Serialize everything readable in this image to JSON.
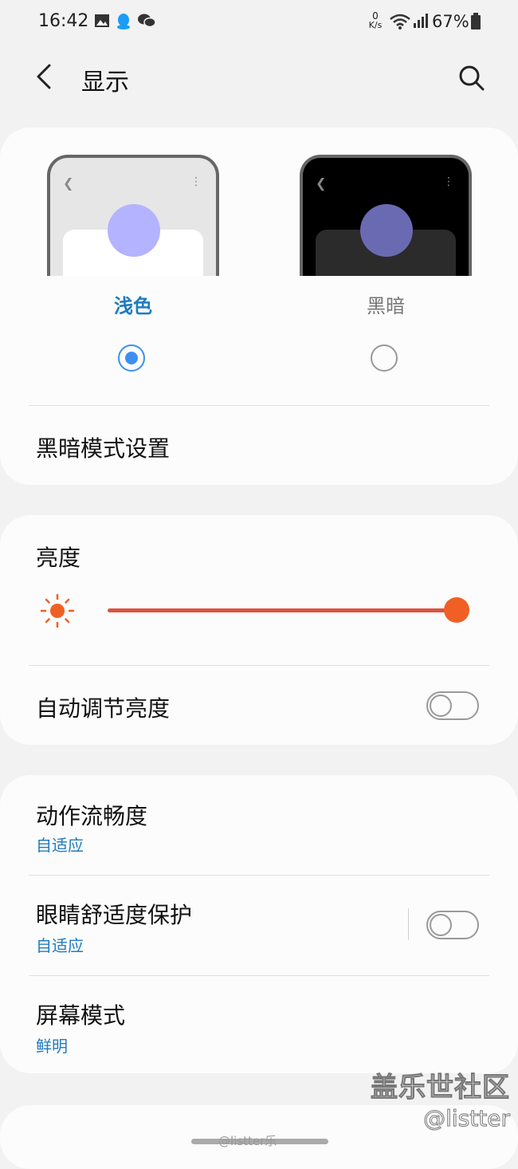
{
  "status_bar": {
    "time": "16:42",
    "left_icons": [
      "image-icon",
      "qq-icon",
      "wechat-icon"
    ],
    "net_speed_top": "0",
    "net_speed_unit": "K/s",
    "battery": "67%",
    "right_icons": [
      "wifi-icon",
      "signal-icon",
      "battery-icon"
    ]
  },
  "appbar": {
    "title": "显示"
  },
  "theme": {
    "light_label": "浅色",
    "dark_label": "黑暗",
    "selected": "light"
  },
  "dark_mode_settings": "黑暗模式设置",
  "brightness": {
    "label": "亮度",
    "level": 1.0
  },
  "auto_brightness": {
    "label": "自动调节亮度",
    "enabled": false
  },
  "motion_smoothness": {
    "label": "动作流畅度",
    "value": "自适应"
  },
  "eye_comfort": {
    "label": "眼睛舒适度保护",
    "value": "自适应",
    "enabled": false
  },
  "screen_mode": {
    "label": "屏幕模式",
    "value": "鲜明"
  },
  "watermark": {
    "line1": "盖乐世社区",
    "line2": "@listter",
    "weibo": "@listter乐"
  },
  "colors": {
    "accent": "#1f7bbf",
    "radio": "#3d8ff0",
    "brightness": "#f06024"
  }
}
